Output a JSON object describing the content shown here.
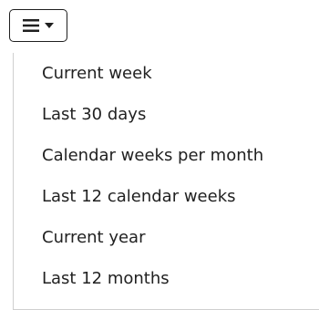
{
  "toggle": {
    "icon": "hamburger-menu-icon",
    "caret_icon": "caret-down-icon"
  },
  "dropdown": {
    "items": [
      {
        "label": "Current week"
      },
      {
        "label": "Last 30 days"
      },
      {
        "label": "Calendar weeks per month"
      },
      {
        "label": "Last 12 calendar weeks"
      },
      {
        "label": "Current year"
      },
      {
        "label": "Last 12 months"
      }
    ]
  },
  "colors": {
    "text": "#212121",
    "border": "#cfcfcf",
    "toggle_border": "#1f1f1f"
  }
}
